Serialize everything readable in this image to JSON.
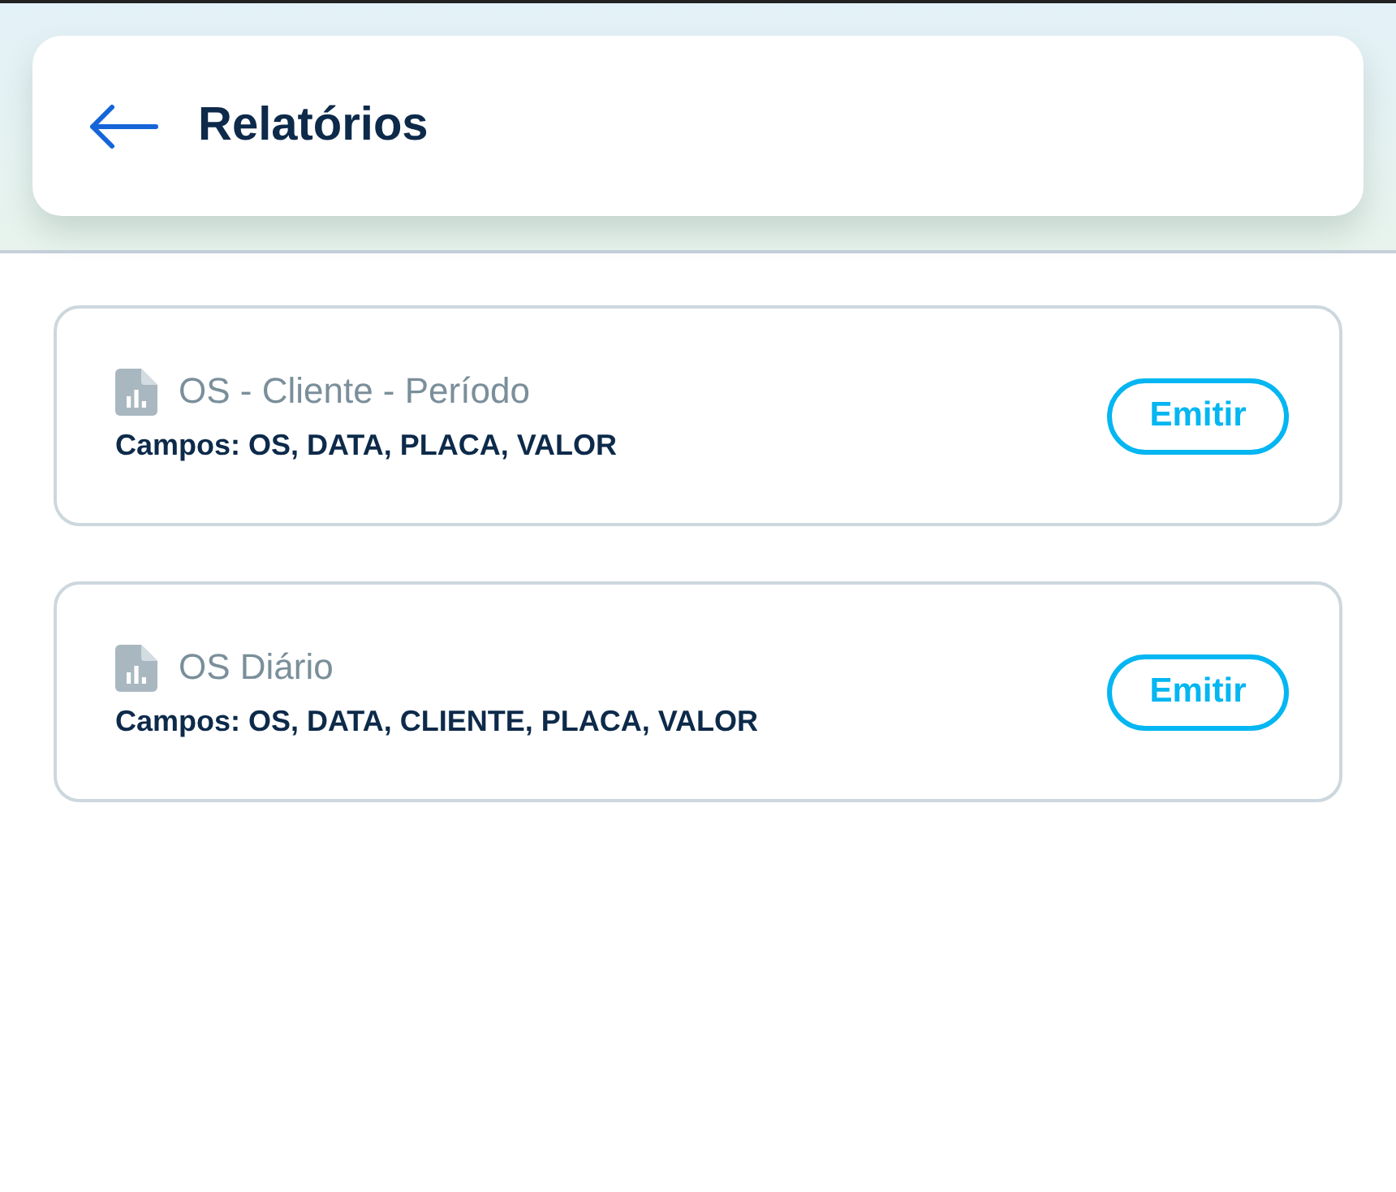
{
  "header": {
    "title": "Relatórios"
  },
  "reports": [
    {
      "title": "OS - Cliente - Período",
      "fields": "Campos: OS, DATA, PLACA, VALOR",
      "button": "Emitir"
    },
    {
      "title": "OS Diário",
      "fields": "Campos: OS, DATA, CLIENTE, PLACA, VALOR",
      "button": "Emitir"
    }
  ]
}
